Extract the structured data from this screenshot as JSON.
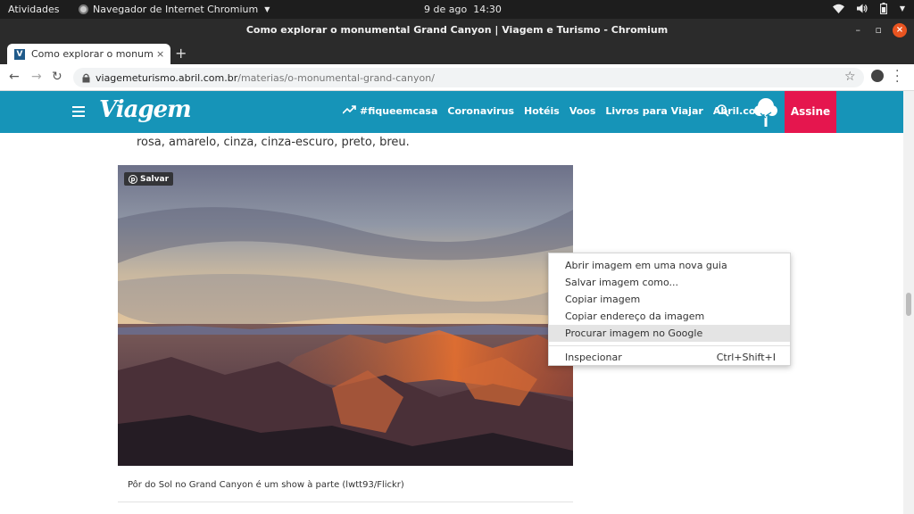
{
  "system_bar": {
    "activities": "Atividades",
    "app_name": "Navegador de Internet Chromium",
    "date": "9 de ago",
    "time": "14:30"
  },
  "window": {
    "title": "Como explorar o monumental Grand Canyon | Viagem e Turismo - Chromium",
    "minimize": "–",
    "maximize": "▫",
    "close": "×"
  },
  "tabs": [
    {
      "title": "Como explorar o monumental Grand Canyon",
      "favicon": "V",
      "close": "×"
    }
  ],
  "new_tab": "+",
  "omnibox": {
    "host": "viagemeturismo.abril.com.br",
    "path": "/materias/o-monumental-grand-canyon/"
  },
  "site": {
    "logo": "Viagem",
    "nav": [
      "#fiqueemcasa",
      "Coronavirus",
      "Hotéis",
      "Voos",
      "Livros para Viajar",
      "Abril.com"
    ],
    "subscribe": "Assine"
  },
  "article": {
    "text": "rosa, amarelo, cinza, cinza-escuro, preto, breu.",
    "pin_label": "Salvar",
    "caption": "Pôr do Sol no Grand Canyon é um show à parte (lwtt93/Flickr)"
  },
  "context_menu": {
    "items": [
      {
        "label": "Abrir imagem em uma nova guia",
        "shortcut": ""
      },
      {
        "label": "Salvar imagem como...",
        "shortcut": ""
      },
      {
        "label": "Copiar imagem",
        "shortcut": ""
      },
      {
        "label": "Copiar endereço da imagem",
        "shortcut": ""
      },
      {
        "label": "Procurar imagem no Google",
        "shortcut": ""
      }
    ],
    "inspect": {
      "label": "Inspecionar",
      "shortcut": "Ctrl+Shift+I"
    }
  },
  "colors": {
    "site_header": "#1694b8",
    "subscribe": "#e5164e",
    "system_bar": "#1d1d1d",
    "close_button": "#e95420"
  }
}
